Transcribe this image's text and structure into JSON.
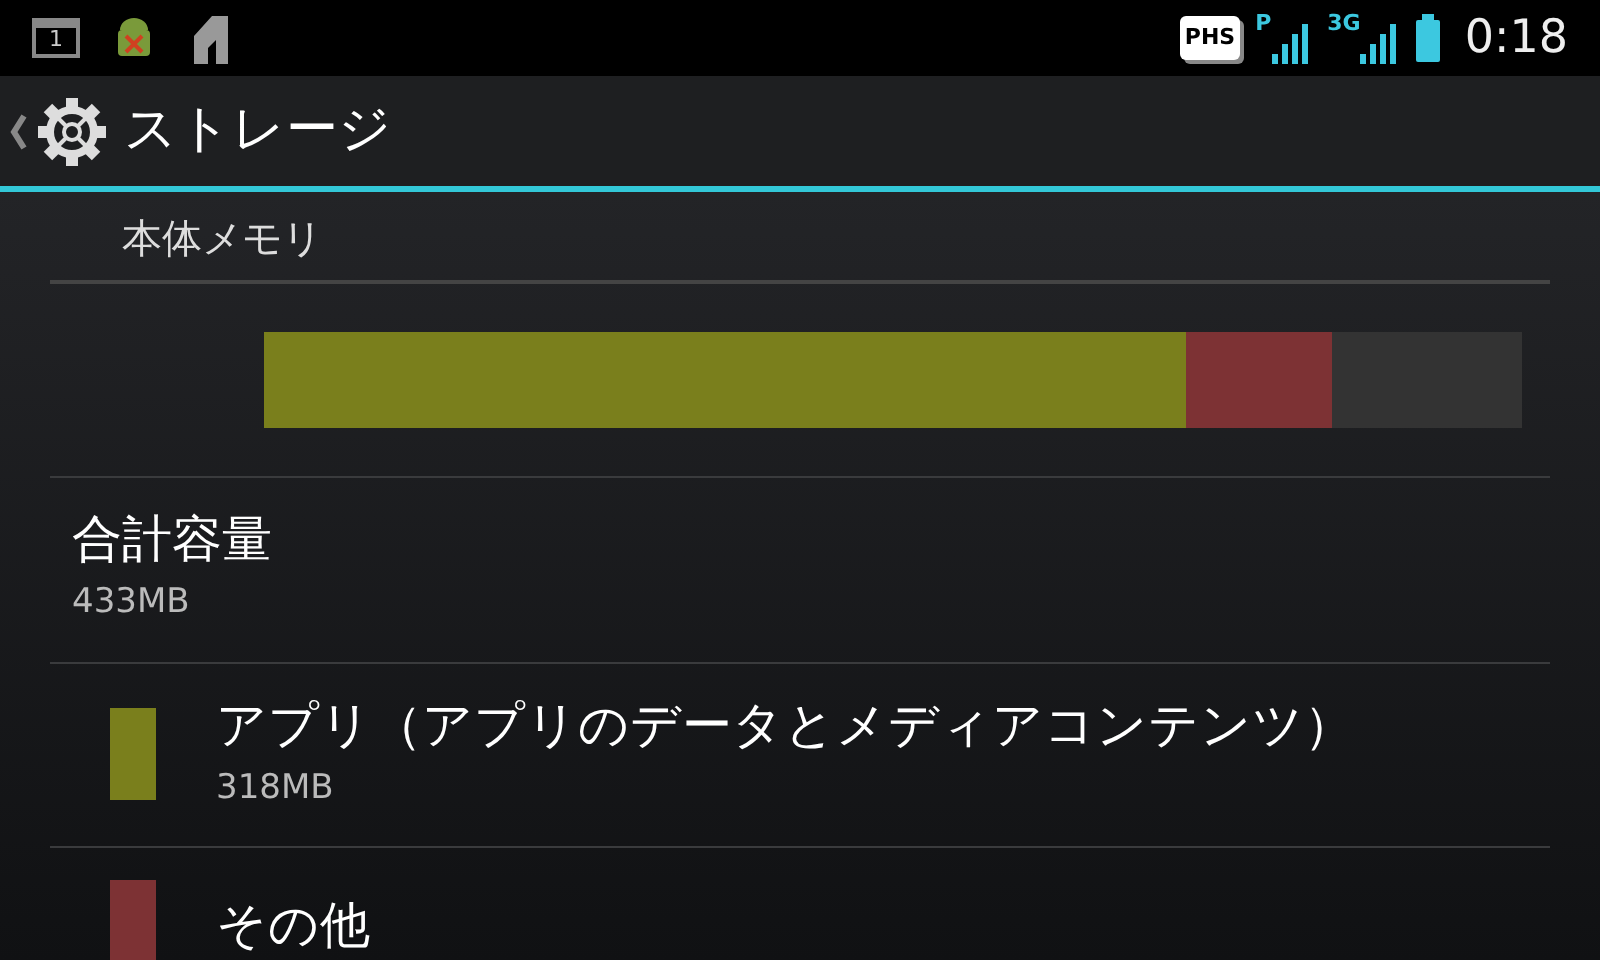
{
  "status_bar": {
    "calendar_day": "1",
    "network_badge": "PHS",
    "signal_1_label": "P",
    "signal_2_label": "3G",
    "time": "0:18"
  },
  "action_bar": {
    "title": "ストレージ"
  },
  "section": {
    "title": "本体メモリ"
  },
  "usage_bar": {
    "segments": [
      {
        "color": "#7a7f1c",
        "level": 0.733
      },
      {
        "color": "#7d3234",
        "level": 0.849
      }
    ]
  },
  "total": {
    "label": "合計容量",
    "value": "433MB"
  },
  "items": [
    {
      "color": "#7a7f1c",
      "title": "アプリ（アプリのデータとメディアコンテンツ）",
      "value": "318MB"
    },
    {
      "color": "#7d3234",
      "title": "その他"
    }
  ]
}
